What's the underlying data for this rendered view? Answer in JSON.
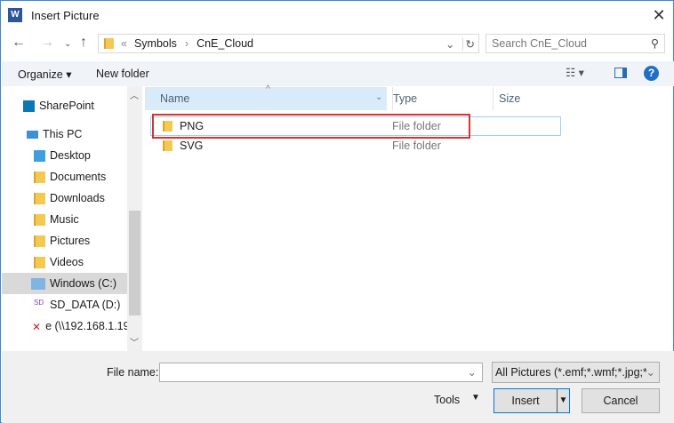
{
  "window": {
    "title": "Insert Picture",
    "app_icon": "W"
  },
  "address": {
    "prefix": "«",
    "crumbs": [
      "Symbols",
      "CnE_Cloud"
    ],
    "sep": "›"
  },
  "search": {
    "placeholder": "Search CnE_Cloud"
  },
  "toolbar": {
    "organize": "Organize ▾",
    "new_folder": "New folder"
  },
  "sidebar": [
    {
      "label": "SharePoint"
    },
    {
      "label": "This PC"
    },
    {
      "label": "Desktop"
    },
    {
      "label": "Documents"
    },
    {
      "label": "Downloads"
    },
    {
      "label": "Music"
    },
    {
      "label": "Pictures"
    },
    {
      "label": "Videos"
    },
    {
      "label": "Windows (C:)"
    },
    {
      "label": "SD_DATA (D:)"
    },
    {
      "label": "e (\\\\192.168.1.19"
    }
  ],
  "columns": {
    "name": "Name",
    "type": "Type",
    "size": "Size"
  },
  "files": [
    {
      "name": "PNG",
      "type": "File folder"
    },
    {
      "name": "SVG",
      "type": "File folder"
    }
  ],
  "footer": {
    "filename_label": "File name:",
    "filename_value": "",
    "filter": "All Pictures (*.emf;*.wmf;*.jpg;*.j",
    "tools": "Tools",
    "insert": "Insert",
    "cancel": "Cancel"
  },
  "colors": {
    "highlight": "#d9342b",
    "accent": "#0078d7"
  }
}
